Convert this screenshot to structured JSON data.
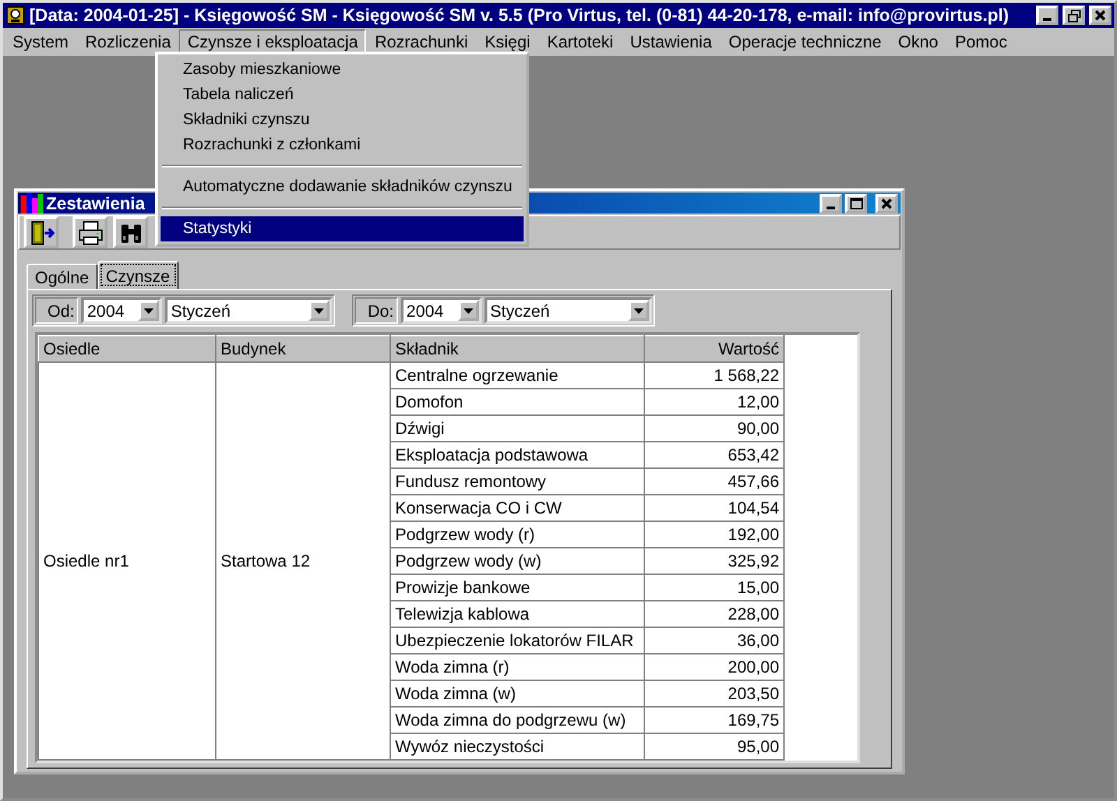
{
  "window": {
    "title": "[Data: 2004-01-25] - Księgowość SM - Księgowość SM v. 5.5 (Pro Virtus, tel. (0-81) 44-20-178, e-mail: info@provirtus.pl)"
  },
  "menu": [
    {
      "label": "System",
      "selected": false
    },
    {
      "label": "Rozliczenia",
      "selected": false
    },
    {
      "label": "Czynsze i eksploatacja",
      "selected": true
    },
    {
      "label": "Rozrachunki",
      "selected": false
    },
    {
      "label": "Księgi",
      "selected": false
    },
    {
      "label": "Kartoteki",
      "selected": false
    },
    {
      "label": "Ustawienia",
      "selected": false
    },
    {
      "label": "Operacje techniczne",
      "selected": false
    },
    {
      "label": "Okno",
      "selected": false
    },
    {
      "label": "Pomoc",
      "selected": false
    }
  ],
  "open_menu": {
    "items": [
      {
        "kind": "item",
        "label": "Zasoby mieszkaniowe",
        "selected": false
      },
      {
        "kind": "item",
        "label": "Tabela naliczeń",
        "selected": false
      },
      {
        "kind": "item",
        "label": "Składniki czynszu",
        "selected": false
      },
      {
        "kind": "item",
        "label": "Rozrachunki z członkami",
        "selected": false
      },
      {
        "kind": "separator"
      },
      {
        "kind": "item",
        "label": "Automatyczne dodawanie składników czynszu",
        "selected": false
      },
      {
        "kind": "separator"
      },
      {
        "kind": "item",
        "label": "Statystyki",
        "selected": true
      }
    ]
  },
  "child_window": {
    "title": "Zestawienia",
    "toolbar": [
      {
        "kind": "exit"
      },
      {
        "kind": "print"
      },
      {
        "kind": "find"
      }
    ],
    "tabs": [
      {
        "label": "Ogólne",
        "selected": false
      },
      {
        "label": "Czynsze",
        "selected": true
      }
    ],
    "filters": [
      {
        "label": "Od:",
        "year": "2004",
        "month": "Styczeń"
      },
      {
        "label": "Do:",
        "year": "2004",
        "month": "Styczeń"
      }
    ],
    "table": {
      "columns": [
        "Osiedle",
        "Budynek",
        "Składnik",
        "Wartość"
      ],
      "groups": [
        {
          "osiedle": "Osiedle nr1",
          "budynek": "Startowa 12",
          "rows": [
            {
              "skladnik": "Centralne ogrzewanie",
              "wartosc": "1 568,22"
            },
            {
              "skladnik": "Domofon",
              "wartosc": "12,00"
            },
            {
              "skladnik": "Dźwigi",
              "wartosc": "90,00"
            },
            {
              "skladnik": "Eksploatacja podstawowa",
              "wartosc": "653,42"
            },
            {
              "skladnik": "Fundusz remontowy",
              "wartosc": "457,66"
            },
            {
              "skladnik": "Konserwacja CO i CW",
              "wartosc": "104,54"
            },
            {
              "skladnik": "Podgrzew wody (r)",
              "wartosc": "192,00"
            },
            {
              "skladnik": "Podgrzew wody (w)",
              "wartosc": "325,92"
            },
            {
              "skladnik": "Prowizje bankowe",
              "wartosc": "15,00"
            },
            {
              "skladnik": "Telewizja kablowa",
              "wartosc": "228,00"
            },
            {
              "skladnik": "Ubezpieczenie lokatorów FILAR",
              "wartosc": "36,00"
            },
            {
              "skladnik": "Woda zimna (r)",
              "wartosc": "200,00"
            },
            {
              "skladnik": "Woda zimna (w)",
              "wartosc": "203,50"
            },
            {
              "skladnik": "Woda zimna do podgrzewu (w)",
              "wartosc": "169,75"
            },
            {
              "skladnik": "Wywóz nieczystości",
              "wartosc": "95,00"
            }
          ]
        }
      ]
    }
  }
}
